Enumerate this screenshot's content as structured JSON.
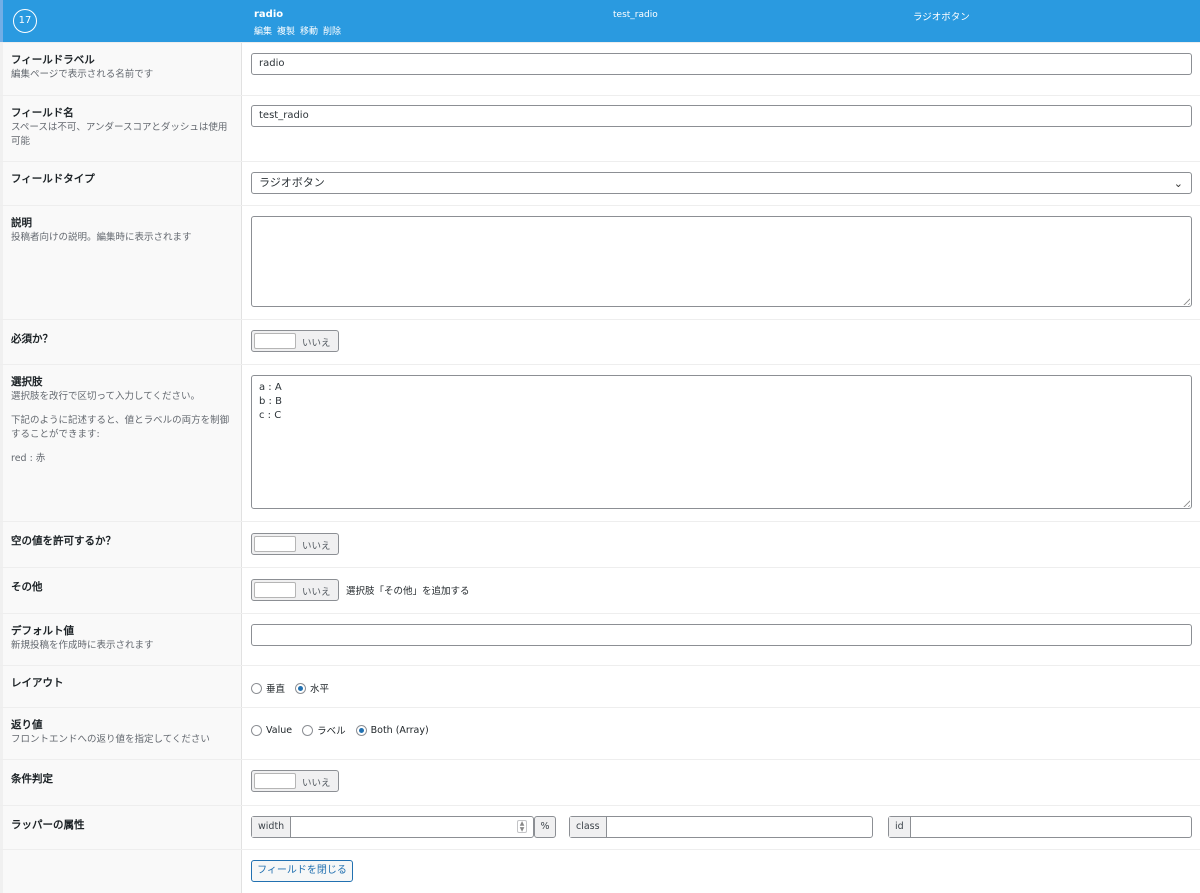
{
  "header": {
    "order": "17",
    "field_label": "radio",
    "actions": [
      "編集",
      "複製",
      "移動",
      "削除"
    ],
    "field_name": "test_radio",
    "field_type": "ラジオボタン"
  },
  "rows": {
    "label": {
      "title": "フィールドラベル",
      "desc": "編集ページで表示される名前です",
      "value": "radio"
    },
    "name": {
      "title": "フィールド名",
      "desc": "スペースは不可、アンダースコアとダッシュは使用可能",
      "value": "test_radio"
    },
    "type": {
      "title": "フィールドタイプ",
      "value": "ラジオボタン"
    },
    "instructions": {
      "title": "説明",
      "desc": "投稿者向けの説明。編集時に表示されます",
      "value": ""
    },
    "required": {
      "title": "必須か？",
      "toggle": "いいえ"
    },
    "choices": {
      "title": "選択肢",
      "desc1": "選択肢を改行で区切って入力してください。",
      "desc2": "下記のように記述すると、値とラベルの両方を制御することができます:",
      "desc3": "red : 赤",
      "lines": [
        "a : A",
        "b : B",
        "c : C"
      ]
    },
    "allow_null": {
      "title": "空の値を許可するか？",
      "toggle": "いいえ"
    },
    "other": {
      "title": "その他",
      "toggle": "いいえ",
      "note": "選択肢「その他」を追加する"
    },
    "default": {
      "title": "デフォルト値",
      "desc": "新規投稿を作成時に表示されます",
      "value": ""
    },
    "layout": {
      "title": "レイアウト",
      "options": [
        "垂直",
        "水平"
      ],
      "selected": "水平"
    },
    "return_format": {
      "title": "返り値",
      "desc": "フロントエンドへの返り値を指定してください",
      "options": [
        "Value",
        "ラベル",
        "Both (Array)"
      ],
      "selected": "Both (Array)"
    },
    "conditional": {
      "title": "条件判定",
      "toggle": "いいえ"
    },
    "wrapper": {
      "title": "ラッパーの属性",
      "width_label": "width",
      "width_unit": "%",
      "class_label": "class",
      "id_label": "id",
      "width_value": "",
      "class_value": "",
      "id_value": ""
    }
  },
  "close_button": "フィールドを閉じる",
  "colors": {
    "header_bg": "#2a9ae0",
    "accent": "#2271b1"
  }
}
